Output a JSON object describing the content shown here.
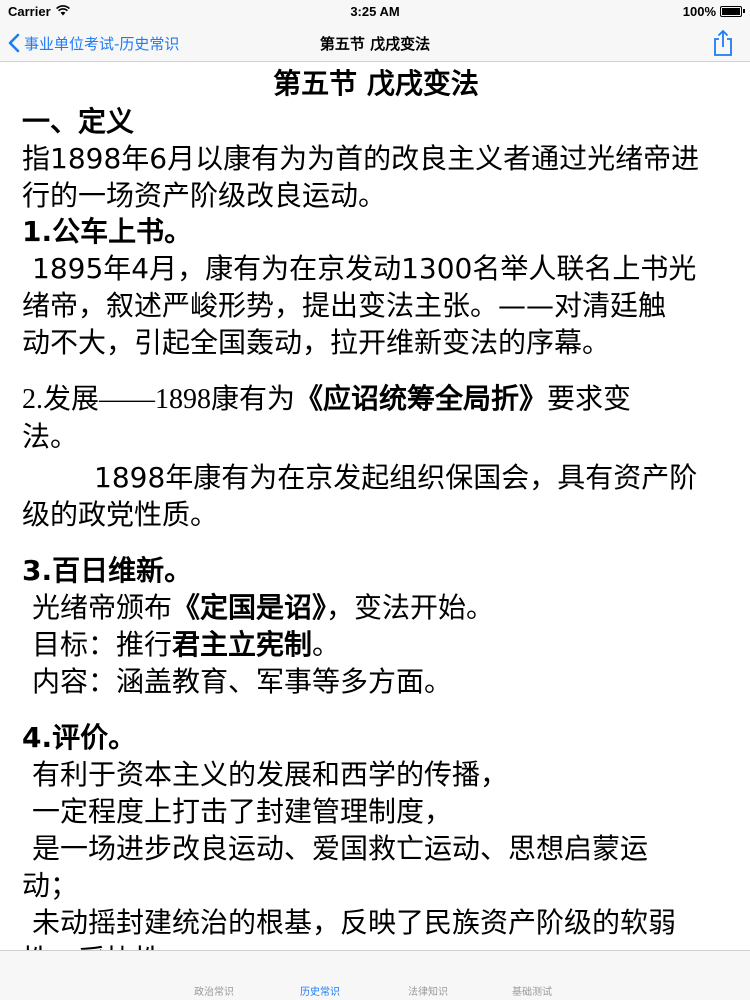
{
  "status_bar": {
    "carrier": "Carrier",
    "time": "3:25 AM",
    "battery": "100%"
  },
  "nav": {
    "back_label": "事业单位考试-历史常识",
    "title": "第五节 戊戌变法"
  },
  "doc": {
    "title": "第五节 戊戌变法",
    "section1_heading": "一、定义",
    "definition_line1": "指1898年6月以康有为为首的改良主义者通过光绪帝进",
    "definition_line2": "行的一场资产阶级改良运动。",
    "item1_heading": "1.公车上书。",
    "item1_line1": "1895年4月，康有为在京发动1300名举人联名上书光",
    "item1_line2": "绪帝，叙述严峻形势，提出变法主张。——对清廷触",
    "item1_line3": "动不大，引起全国轰动，拉开维新变法的序幕。",
    "item2_prefix": "2.发展——1898康有为",
    "item2_book": "《应诏统筹全局折》",
    "item2_suffix": "要求变",
    "item2_line2": "法。",
    "item2_para_line1": "1898年康有为在京发起组织保国会，具有资产阶",
    "item2_para_line2": "级的政党性质。",
    "item3_heading": "3.百日维新。",
    "item3_line1_prefix": "光绪帝颁布",
    "item3_line1_book": "《定国是诏》",
    "item3_line1_suffix": "，变法开始。",
    "item3_goal_prefix": "目标：推行",
    "item3_goal_bold": "君主立宪制",
    "item3_goal_suffix": "。",
    "item3_content": "内容：涵盖教育、军事等多方面。",
    "item4_heading": "4.评价。",
    "item4_line1": "有利于资本主义的发展和西学的传播，",
    "item4_line2": "一定程度上打击了封建管理制度，",
    "item4_line3": "是一场进步改良运动、爱国救亡运动、思想启蒙运",
    "item4_line4": "动；",
    "item4_line5": "未动摇封建统治的根基，反映了民族资产阶级的软弱",
    "item4_line6": "性、妥协性。"
  },
  "tabs": [
    {
      "label": "政治常识",
      "active": false
    },
    {
      "label": "历史常识",
      "active": true
    },
    {
      "label": "法律知识",
      "active": false
    },
    {
      "label": "基础测试",
      "active": false
    }
  ],
  "colors": {
    "accent": "#1e7cf5",
    "inactive_tab": "#9a9a9a",
    "bar_background": "#f7f7f7"
  },
  "icons": {
    "back": "chevron-left-icon",
    "share": "share-icon",
    "wifi": "wifi-icon",
    "battery": "battery-icon"
  }
}
